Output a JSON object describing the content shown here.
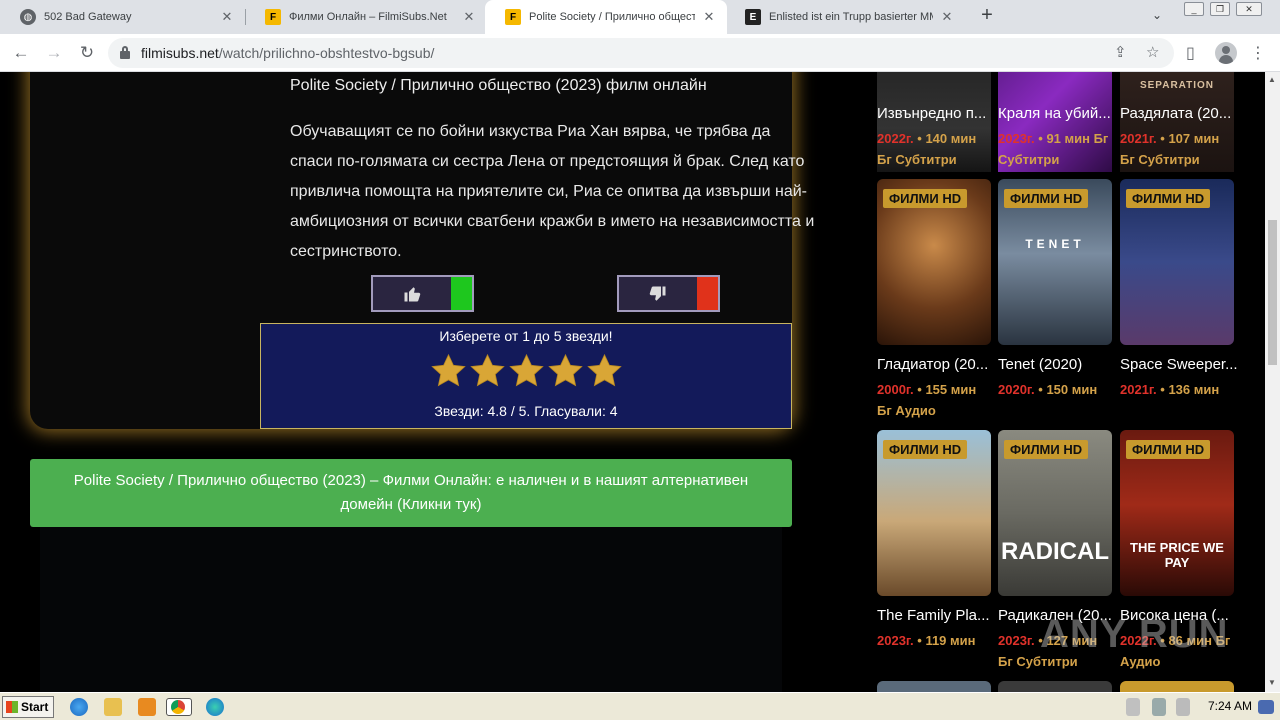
{
  "tabs": [
    {
      "title": "502 Bad Gateway",
      "active": false
    },
    {
      "title": "Филми Онлайн – FilmiSubs.Net",
      "active": false
    },
    {
      "title": "Polite Society / Прилично обществ",
      "active": true
    },
    {
      "title": "Enlisted ist ein Trupp basierter MMO-",
      "active": false
    }
  ],
  "address": {
    "host": "filmisubs.net",
    "path": "/watch/prilichno-obshtestvo-bgsub/"
  },
  "movie": {
    "title_line": "Polite Society / Прилично общество (2023) филм онлайн",
    "description": "Обучаващият се по бойни изкуства Риа Хан вярва, че трябва да спаси по-голямата си сестра Лена от предстоящия й брак. След като привлича помощта на приятелите си, Риа се опитва да извърши най-амбициозния от всички сватбени кражби в името на независимостта и сестринството."
  },
  "rating": {
    "prompt": "Изберете от 1 до 5 звезди!",
    "info": "Звезди: 4.8 / 5. Гласували: 4",
    "value": 4.8,
    "max": 5,
    "votes": 4
  },
  "alt_domain": {
    "text": "Polite Society / Прилично общество (2023) – Филми Онлайн: е наличен и в нашият алтернативен домейн (Кликни тук)"
  },
  "sidebar": {
    "badge": "ФИЛМИ HD",
    "row0": [
      {
        "title": "Извънредно п...",
        "year": "2022г.",
        "rest": "• 140 мин Бг Субтитри"
      },
      {
        "title": "Краля на убий...",
        "year": "2023г.",
        "rest": "• 91 мин Бг Субтитри"
      },
      {
        "title": "Раздялата (20...",
        "year": "2021г.",
        "rest": "• 107 мин Бг Субтитри"
      }
    ],
    "row1": [
      {
        "title": "Гладиатор (20...",
        "year": "2000г.",
        "rest": "• 155 мин Бг Аудио"
      },
      {
        "title": "Tenet (2020)",
        "year": "2020г.",
        "rest": "• 150 мин"
      },
      {
        "title": "Space Sweeper...",
        "year": "2021г.",
        "rest": "• 136 мин"
      }
    ],
    "row2": [
      {
        "title": "The Family Pla...",
        "year": "2023г.",
        "rest": "• 119 мин"
      },
      {
        "title": "Радикален (20...",
        "year": "2023г.",
        "rest": "• 127 мин Бг Субтитри"
      },
      {
        "title": "Висока цена (...",
        "year": "2022г.",
        "rest": "• 86 мин Бг Аудио"
      }
    ],
    "poster_texts": {
      "separation": "SEPARATION",
      "tenet": "TENET",
      "radical": "RADICAL",
      "price": "THE PRICE WE PAY"
    }
  },
  "watermark": "ANY RUN",
  "taskbar": {
    "start": "Start",
    "clock": "7:24 AM"
  },
  "colors": {
    "accent_gold": "#c89a2d",
    "rating_bg": "#131a5a",
    "like_green": "#1ec71e",
    "dislike_red": "#e0321b",
    "alt_green": "#4caf50",
    "year_red": "#e0322b"
  }
}
